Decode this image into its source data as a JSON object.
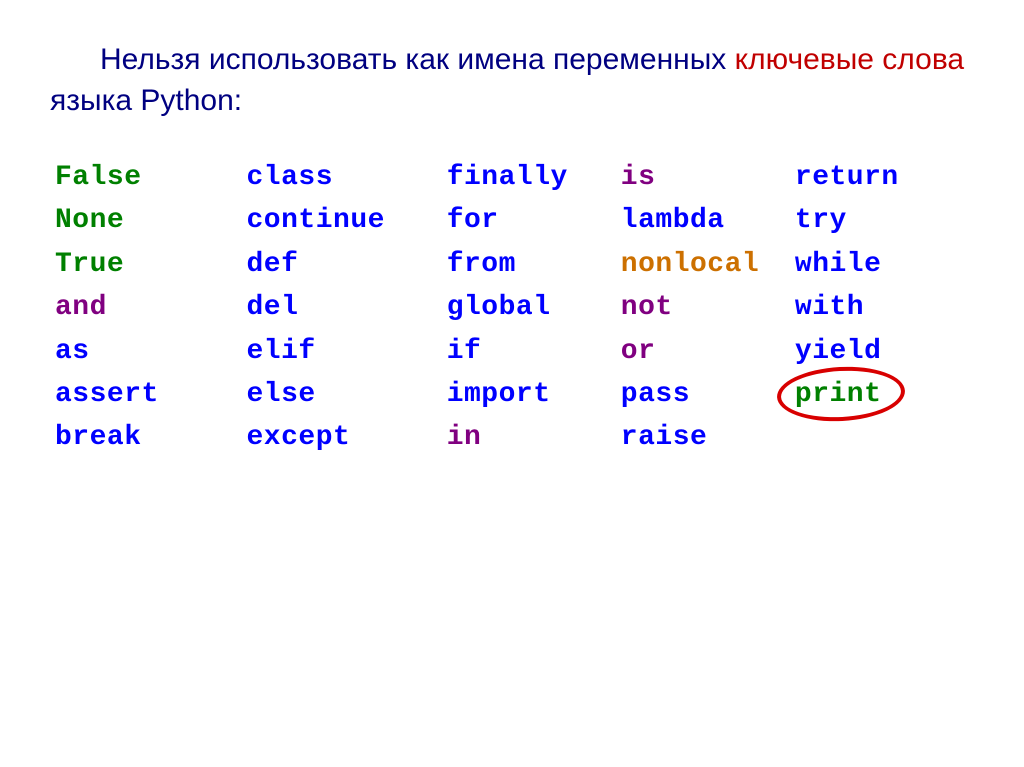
{
  "heading": {
    "part1": "Нельзя использовать как имена переменных ",
    "part2_red": "ключевые слова",
    "part3": " языка Python:"
  },
  "columns": [
    [
      {
        "text": "False",
        "color": "green"
      },
      {
        "text": "None",
        "color": "green"
      },
      {
        "text": "True",
        "color": "green"
      },
      {
        "text": "and",
        "color": "purple"
      },
      {
        "text": "as",
        "color": "blue"
      },
      {
        "text": "assert",
        "color": "blue"
      },
      {
        "text": "break",
        "color": "blue"
      }
    ],
    [
      {
        "text": "class",
        "color": "blue"
      },
      {
        "text": "continue",
        "color": "blue"
      },
      {
        "text": "def",
        "color": "blue"
      },
      {
        "text": "del",
        "color": "blue"
      },
      {
        "text": "elif",
        "color": "blue"
      },
      {
        "text": "else",
        "color": "blue"
      },
      {
        "text": "except",
        "color": "blue"
      }
    ],
    [
      {
        "text": "finally",
        "color": "blue"
      },
      {
        "text": "for",
        "color": "blue"
      },
      {
        "text": "from",
        "color": "blue"
      },
      {
        "text": "global",
        "color": "blue"
      },
      {
        "text": "if",
        "color": "blue"
      },
      {
        "text": "import",
        "color": "blue"
      },
      {
        "text": "in",
        "color": "purple"
      }
    ],
    [
      {
        "text": "is",
        "color": "purple"
      },
      {
        "text": "lambda",
        "color": "blue"
      },
      {
        "text": "nonlocal",
        "color": "orange"
      },
      {
        "text": "not",
        "color": "purple"
      },
      {
        "text": "or",
        "color": "purple"
      },
      {
        "text": "pass",
        "color": "blue"
      },
      {
        "text": "raise",
        "color": "blue"
      }
    ],
    [
      {
        "text": "return",
        "color": "blue"
      },
      {
        "text": "try",
        "color": "blue"
      },
      {
        "text": "while",
        "color": "blue"
      },
      {
        "text": "with",
        "color": "blue"
      },
      {
        "text": "yield",
        "color": "blue"
      },
      {
        "text": "print",
        "color": "green",
        "circled": true
      }
    ]
  ]
}
